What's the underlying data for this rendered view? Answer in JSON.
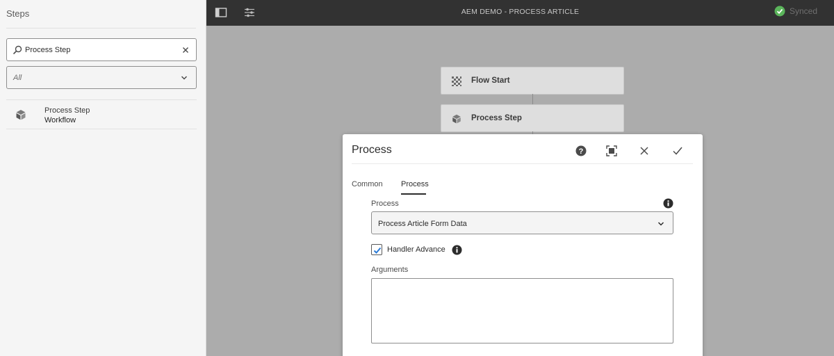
{
  "sidebar": {
    "title": "Steps",
    "search": {
      "value": "Process Step",
      "placeholder": ""
    },
    "filter": {
      "selected": "All"
    },
    "items": [
      {
        "name": "Process Step",
        "category": "Workflow",
        "icon": "cube-icon"
      }
    ]
  },
  "topbar": {
    "title": "AEM DEMO - PROCESS ARTICLE",
    "status": "Synced",
    "status_color": "#5bb55b"
  },
  "canvas": {
    "nodes": [
      {
        "label": "Flow Start",
        "icon": "flow-start-icon"
      },
      {
        "label": "Process Step",
        "icon": "cube-icon"
      }
    ]
  },
  "dialog": {
    "title": "Process",
    "tabs": [
      {
        "label": "Common",
        "active": false
      },
      {
        "label": "Process",
        "active": true
      }
    ],
    "process_field": {
      "label": "Process",
      "value": "Process Article Form Data"
    },
    "handler_advance": {
      "label": "Handler Advance",
      "checked": true
    },
    "arguments_field": {
      "label": "Arguments",
      "value": ""
    }
  },
  "colors": {
    "checkbox_accent": "#2b7bd6",
    "topbar_bg": "#323232",
    "canvas_bg": "#acacac"
  }
}
